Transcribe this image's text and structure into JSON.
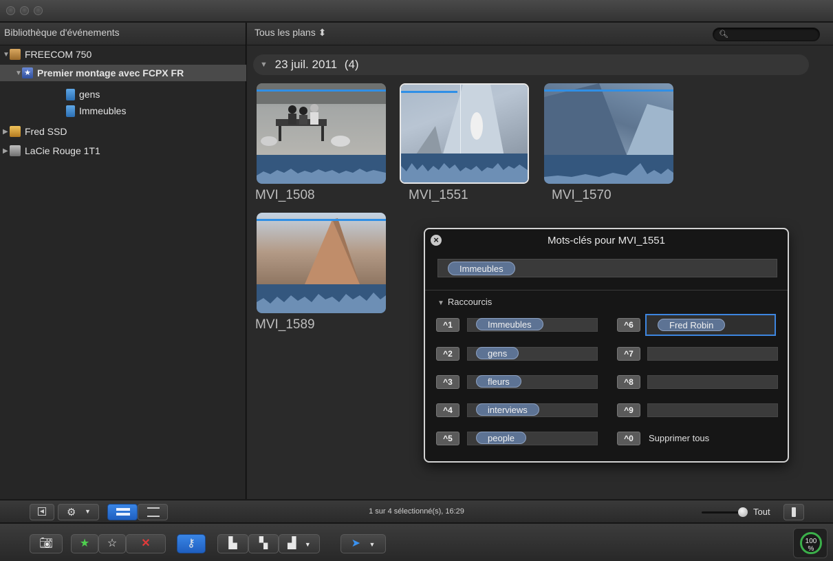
{
  "library": {
    "header": "Bibliothèque d'événements",
    "items": [
      {
        "label": "FREECOM 750"
      },
      {
        "label": "Premier montage avec FCPX FR"
      },
      {
        "label": "gens"
      },
      {
        "label": "Immeubles"
      },
      {
        "label": "Fred SSD"
      },
      {
        "label": "LaCie Rouge 1T1"
      }
    ]
  },
  "browser": {
    "filter_label": "Tous les plans ⬍",
    "search_placeholder": "",
    "date_group": "23 juil. 2011",
    "date_count": "(4)",
    "clips": [
      {
        "name": "MVI_1508"
      },
      {
        "name": "MVI_1551"
      },
      {
        "name": "MVI_1570"
      },
      {
        "name": "MVI_1589"
      }
    ]
  },
  "hud": {
    "title": "Mots-clés pour MVI_1551",
    "field_keyword": "Immeubles",
    "section": "Raccourcis",
    "shortcuts": [
      {
        "key": "^1",
        "keyword": "Immeubles"
      },
      {
        "key": "^2",
        "keyword": "gens"
      },
      {
        "key": "^3",
        "keyword": "fleurs"
      },
      {
        "key": "^4",
        "keyword": "interviews"
      },
      {
        "key": "^5",
        "keyword": "people"
      },
      {
        "key": "^6",
        "keyword": "Fred Robin"
      },
      {
        "key": "^7",
        "keyword": ""
      },
      {
        "key": "^8",
        "keyword": ""
      },
      {
        "key": "^9",
        "keyword": ""
      },
      {
        "key": "^0",
        "keyword": "Supprimer tous"
      }
    ]
  },
  "statusbar": {
    "selection_text": "1 sur 4 sélectionné(s), 16:29",
    "zoom_label": "Tout"
  },
  "toolbar": {
    "progress": "100 %"
  },
  "colors": {
    "accent": "#2f8fe6",
    "keyword_token": "#5d7394",
    "progress_ring": "#3bb04a"
  },
  "icons": [
    "import-icon",
    "favorite-star-icon",
    "unrate-star-icon",
    "reject-x-icon",
    "keyword-key-icon",
    "connect-clip-icon",
    "insert-clip-icon",
    "append-clip-icon",
    "select-arrow-icon",
    "gear-icon",
    "search-icon"
  ]
}
